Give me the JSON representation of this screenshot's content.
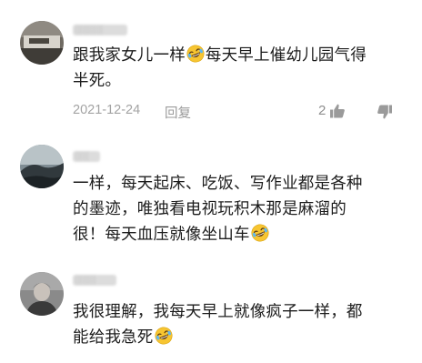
{
  "comments": [
    {
      "username_masked": "░░░░",
      "line1": "跟我家女儿一样",
      "line1b": "每天早上催幼儿园气得",
      "line2": "半死。",
      "date": "2021-12-24",
      "reply_label": "回复",
      "like_count": "2"
    },
    {
      "username_masked": "░░",
      "line1": "一样，每天起床、吃饭、写作业都是各种",
      "line2": "的墨迹，唯独看电视玩积木那是麻溜的",
      "line3": "很！每天血压就像坐山车"
    },
    {
      "username_masked": "░░░",
      "line1": "我很理解，我每天早上就像疯子一样，都",
      "line2": "能给我急死"
    }
  ],
  "icons": {
    "emoji": "rolling-on-floor-laughing-emoji",
    "like": "thumbs-up-icon",
    "dislike": "thumbs-down-icon"
  },
  "colors": {
    "text": "#1c1c1c",
    "meta": "#a3a3a3",
    "emoji_face": "#f7c531"
  }
}
